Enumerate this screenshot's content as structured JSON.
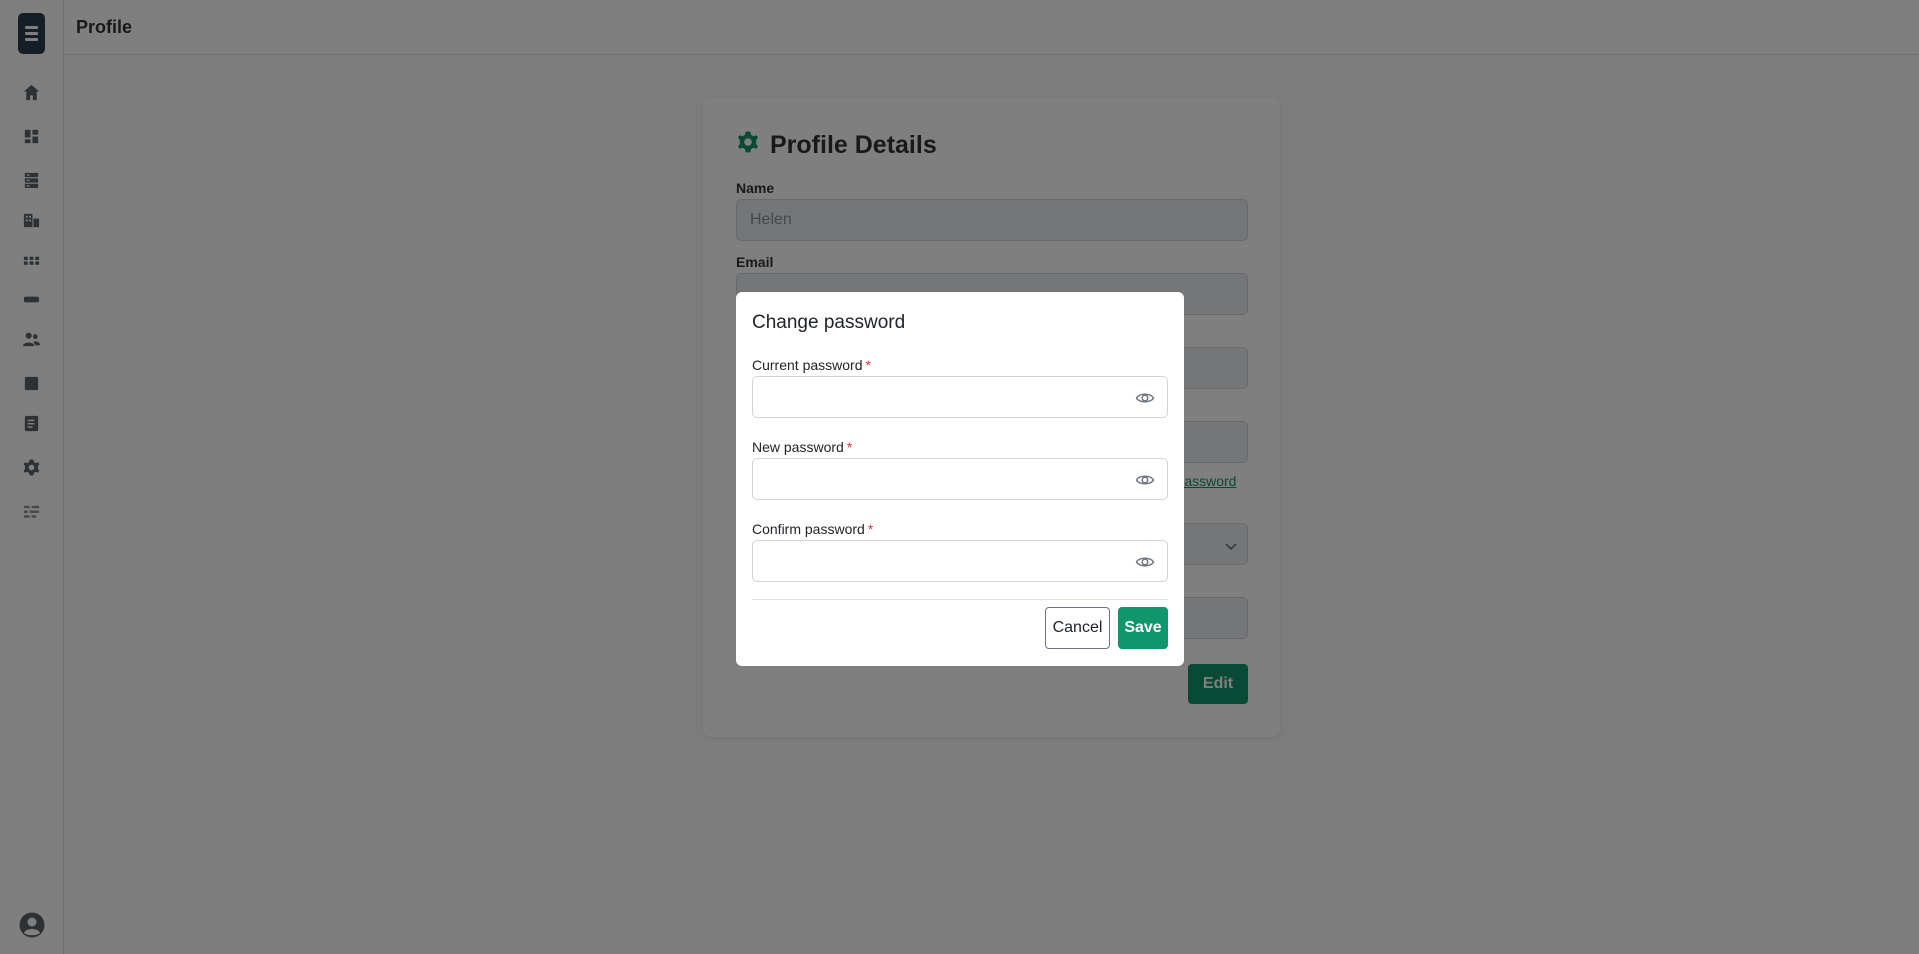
{
  "header": {
    "title": "Profile"
  },
  "sidebar": {
    "items": [
      {
        "icon": "home-icon"
      },
      {
        "icon": "dashboard-icon"
      },
      {
        "icon": "server-icon"
      },
      {
        "icon": "buildings-icon"
      },
      {
        "icon": "grid-icon"
      },
      {
        "icon": "tag-icon"
      },
      {
        "icon": "users-icon"
      },
      {
        "icon": "table-icon"
      },
      {
        "icon": "document-icon"
      },
      {
        "icon": "gear-icon"
      },
      {
        "icon": "list-icon"
      }
    ],
    "avatar_icon": "user-circle-icon"
  },
  "profile": {
    "title": "Profile Details",
    "name_label": "Name",
    "name_value": "Helen",
    "email_label": "Email",
    "email_value": "",
    "change_password_link": "Password",
    "edit_button": "Edit"
  },
  "modal": {
    "title": "Change password",
    "fields": [
      {
        "label": "Current password",
        "required": "*",
        "value": ""
      },
      {
        "label": "New password",
        "required": "*",
        "value": ""
      },
      {
        "label": "Confirm password",
        "required": "*",
        "value": ""
      }
    ],
    "cancel_label": "Cancel",
    "save_label": "Save"
  },
  "colors": {
    "accent": "#11956a",
    "required": "#dc3545",
    "logo": "#2d3e50"
  }
}
